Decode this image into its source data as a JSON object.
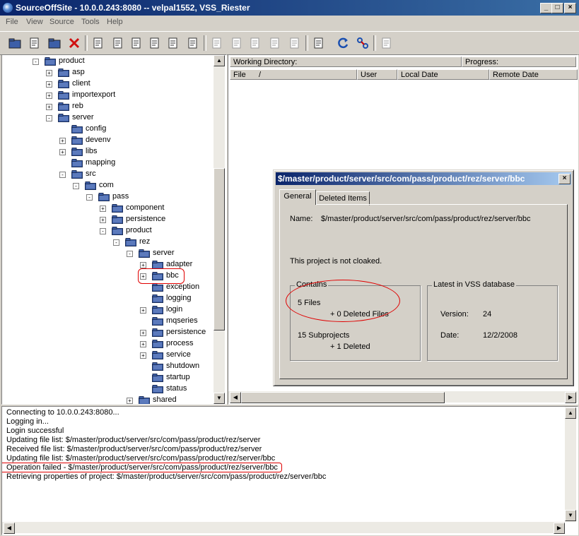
{
  "window": {
    "title": "SourceOffSite - 10.0.0.243:8080 -- velpal1552, VSS_Riester",
    "controls": {
      "minimize": "_",
      "maximize": "□",
      "close": "×"
    }
  },
  "menu": [
    "File",
    "View",
    "Source",
    "Tools",
    "Help"
  ],
  "toolbar_icons": [
    "open-folder-icon",
    "add-file-icon",
    "add-folder-icon",
    "delete-icon",
    "get-latest-icon",
    "check-out-icon",
    "check-in-icon",
    "undo-checkout-icon",
    "share-icon",
    "branch-icon",
    "view-icon",
    "edit-icon",
    "diff-icon",
    "properties-icon",
    "copy-icon",
    "history-icon",
    "refresh-icon",
    "link-icon",
    "label-icon"
  ],
  "tree": [
    {
      "label": "product",
      "level": 2,
      "exp": "-"
    },
    {
      "label": "asp",
      "level": 3,
      "exp": "+"
    },
    {
      "label": "client",
      "level": 3,
      "exp": "+"
    },
    {
      "label": "importexport",
      "level": 3,
      "exp": "+"
    },
    {
      "label": "reb",
      "level": 3,
      "exp": "+"
    },
    {
      "label": "server",
      "level": 3,
      "exp": "-"
    },
    {
      "label": "config",
      "level": 4,
      "exp": ""
    },
    {
      "label": "devenv",
      "level": 4,
      "exp": "+"
    },
    {
      "label": "libs",
      "level": 4,
      "exp": "+"
    },
    {
      "label": "mapping",
      "level": 4,
      "exp": ""
    },
    {
      "label": "src",
      "level": 4,
      "exp": "-"
    },
    {
      "label": "com",
      "level": 5,
      "exp": "-"
    },
    {
      "label": "pass",
      "level": 6,
      "exp": "-"
    },
    {
      "label": "component",
      "level": 7,
      "exp": "+"
    },
    {
      "label": "persistence",
      "level": 7,
      "exp": "+"
    },
    {
      "label": "product",
      "level": 7,
      "exp": "-"
    },
    {
      "label": "rez",
      "level": 8,
      "exp": "-"
    },
    {
      "label": "server",
      "level": 9,
      "exp": "-"
    },
    {
      "label": "adapter",
      "level": 10,
      "exp": "+"
    },
    {
      "label": "bbc",
      "level": 10,
      "exp": "+"
    },
    {
      "label": "exception",
      "level": 10,
      "exp": ""
    },
    {
      "label": "logging",
      "level": 10,
      "exp": ""
    },
    {
      "label": "login",
      "level": 10,
      "exp": "+"
    },
    {
      "label": "mqseries",
      "level": 10,
      "exp": ""
    },
    {
      "label": "persistence",
      "level": 10,
      "exp": "+"
    },
    {
      "label": "process",
      "level": 10,
      "exp": "+"
    },
    {
      "label": "service",
      "level": 10,
      "exp": "+"
    },
    {
      "label": "shutdown",
      "level": 10,
      "exp": ""
    },
    {
      "label": "startup",
      "level": 10,
      "exp": ""
    },
    {
      "label": "status",
      "level": 10,
      "exp": ""
    },
    {
      "label": "shared",
      "level": 9,
      "exp": "+"
    }
  ],
  "file_pane": {
    "working_directory_label": "Working Directory:",
    "progress_label": "Progress:",
    "columns": [
      "File",
      "User",
      "Local Date",
      "Remote Date"
    ],
    "sort_indicator": "/"
  },
  "dialog": {
    "title": "$/master/product/server/src/com/pass/product/rez/server/bbc",
    "close": "×",
    "tabs": [
      "General",
      "Deleted Items"
    ],
    "name_label": "Name:",
    "name_value": "$/master/product/server/src/com/pass/product/rez/server/bbc",
    "cloak_status": "This project is not cloaked.",
    "contains": {
      "title": "Contains",
      "files": "5 Files",
      "deleted_files": "+ 0 Deleted Files",
      "subprojects": "15 Subprojects",
      "deleted_subprojects": "+ 1 Deleted"
    },
    "latest": {
      "title": "Latest in VSS database",
      "version_label": "Version:",
      "version_value": "24",
      "date_label": "Date:",
      "date_value": "12/2/2008"
    }
  },
  "log": [
    "Connecting to 10.0.0.243:8080...",
    "Logging in...",
    "Login successful",
    "Updating file list: $/master/product/server/src/com/pass/product/rez/server",
    "Received file list: $/master/product/server/src/com/pass/product/rez/server",
    "Updating file list: $/master/product/server/src/com/pass/product/rez/server/bbc",
    "Operation failed - $/master/product/server/src/com/pass/product/rez/server/bbc",
    "Retrieving properties of project: $/master/product/server/src/com/pass/product/rez/server/bbc"
  ],
  "colors": {
    "title_start": "#0a246a",
    "title_end": "#3a6ea5",
    "annotation": "#e00000",
    "folder": "#3d5fa8"
  }
}
